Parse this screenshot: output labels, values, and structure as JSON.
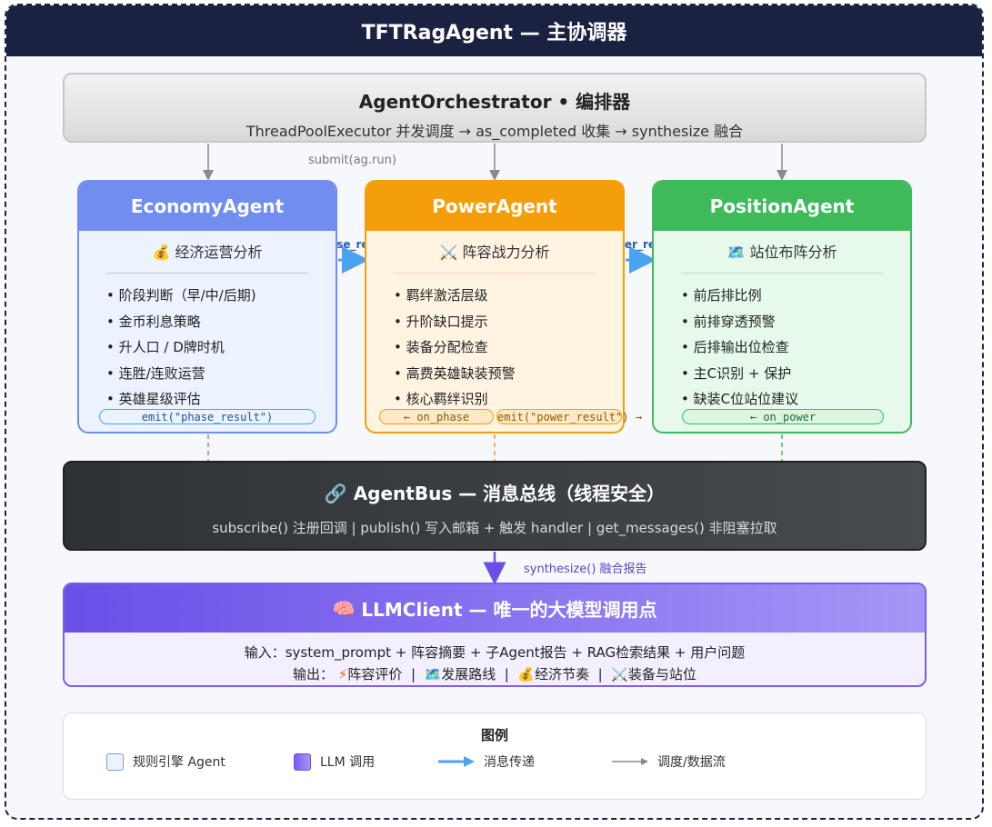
{
  "title": "TFTRagAgent — 主协调器",
  "orchestrator": {
    "title": "AgentOrchestrator • 编排器",
    "subtitle": "ThreadPoolExecutor 并发调度 → as_completed 收集 → synthesize 融合",
    "submit_label": "submit(ag.run)"
  },
  "agents": [
    {
      "name": "EconomyAgent",
      "icon": "money-bag-icon",
      "subtitle": "经济运营分析",
      "items": [
        "阶段判断（早/中/后期)",
        "金币利息策略",
        "升人口 / D牌时机",
        "连胜/连败运营",
        "英雄星级评估"
      ],
      "emit": "emit(\"phase_result\")",
      "color": "#6f8ef0"
    },
    {
      "name": "PowerAgent",
      "icon": "crossed-swords-icon",
      "subtitle": "阵容战力分析",
      "items": [
        "羁绊激活层级",
        "升阶缺口提示",
        "装备分配检查",
        "高费英雄缺装预警",
        "核心羁绊识别"
      ],
      "on": "← on_phase",
      "emit": "emit(\"power_result\") →",
      "color": "#f59e0b"
    },
    {
      "name": "PositionAgent",
      "icon": "map-icon",
      "subtitle": "站位布阵分析",
      "items": [
        "前后排比例",
        "前排穿透预警",
        "后排输出位检查",
        "主C识别 + 保护",
        "缺装C位站位建议"
      ],
      "on": "← on_power",
      "color": "#3fba5a"
    }
  ],
  "messages": {
    "phase_result": "phase_result",
    "power_result": "power_result"
  },
  "bus": {
    "icon": "link-icon",
    "title": "AgentBus — 消息总线（线程安全）",
    "subtitle": "subscribe() 注册回调  |  publish() 写入邮箱 + 触发 handler  |  get_messages() 非阻塞拉取",
    "synthesize_label": "synthesize() 融合报告"
  },
  "llm": {
    "icon": "brain-icon",
    "title": "LLMClient — 唯一的大模型调用点",
    "input_line": "输入：system_prompt + 阵容摘要 + 子Agent报告 + RAG检索结果 + 用户问题",
    "output_prefix": "输出：",
    "outputs": [
      {
        "icon": "lightning-icon",
        "label": "阵容评价"
      },
      {
        "icon": "map-icon",
        "label": "发展路线"
      },
      {
        "icon": "money-bag-icon",
        "label": "经济节奏"
      },
      {
        "icon": "crossed-swords-icon",
        "label": "装备与站位"
      }
    ]
  },
  "legend": {
    "title": "图例",
    "items": [
      {
        "label": "规则引擎 Agent",
        "icon": "light-blue-square-icon"
      },
      {
        "label": "LLM 调用",
        "icon": "purple-square-icon"
      },
      {
        "label": "消息传递",
        "icon": "blue-arrow-icon"
      },
      {
        "label": "调度/数据流",
        "icon": "gray-arrow-icon"
      }
    ]
  }
}
